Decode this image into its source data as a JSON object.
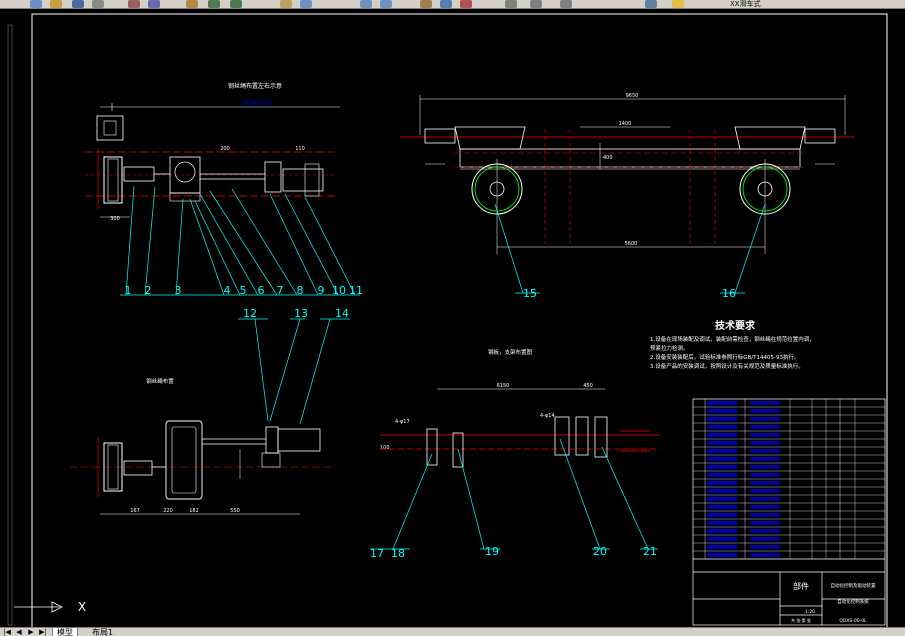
{
  "toolbar": {
    "icons": [
      "new-icon",
      "open-icon",
      "save-icon",
      "print-icon",
      "cut-icon",
      "copy-icon",
      "paste-icon",
      "undo-icon",
      "redo-icon",
      "pan-icon",
      "zoom-realtime-icon",
      "zoom-window-icon",
      "zoom-previous-icon",
      "properties-icon",
      "design-center-icon",
      "tool-palettes-icon",
      "text-style-icon",
      "dim-style-icon",
      "table-style-icon",
      "layer-icon"
    ],
    "layer_name": "XX滑车式"
  },
  "drawing": {
    "top_left_title": "钢丝绳布置左右示意",
    "middle_left_title": "钢丝绳布置",
    "middle_center_title": "钢板，支架布置图",
    "tech_req_title": "技术要求",
    "tech_req_lines": [
      "1.设备在现场装配及调试，装配前需检查，钢丝绳在规范位置内调，",
      "   预紧拉力检测。",
      "2.设备安装装配后，试验标准参照行标GB/T14405-93执行。",
      "3.设备产品的安装调试，按照设计及有关规范及质量标准执行。"
    ],
    "top_dim_label": "2709(±5)",
    "right_dim_top": "9650",
    "right_dim_bottom": "5600",
    "right_dim_mid": "1400",
    "right_dim_small": "400",
    "callouts_upper_left": [
      "1",
      "2",
      "3",
      "4",
      "5",
      "6",
      "7",
      "8",
      "9",
      "10",
      "11"
    ],
    "callouts_right": [
      "15",
      "16"
    ],
    "callouts_lower_left": [
      "12",
      "13",
      "14"
    ],
    "callouts_lower_center": [
      "17",
      "18",
      "19",
      "20",
      "21"
    ],
    "lower_dims": [
      "167",
      "220",
      "182",
      "550"
    ],
    "middle_dims": [
      "6150",
      "4-φ17",
      "450",
      "4-φ14",
      "100"
    ],
    "title_block": {
      "part_label": "部件",
      "drawing_name": "自动化控制及驱动装置",
      "drawing_title": "自动化控制系统",
      "scale_label": "1:20",
      "sheet_label": "共 张 第 张",
      "code": "QDXS-00-0L"
    }
  },
  "tabs": [
    "模型",
    "布局1"
  ],
  "axis": {
    "label": "X"
  },
  "colors": {
    "background": "#000000",
    "lines": "#ffffff",
    "red": "#ff0000",
    "cyan": "#00ffff",
    "blue": "#0000ff",
    "green": "#00ff00",
    "yellow": "#ffff00"
  }
}
